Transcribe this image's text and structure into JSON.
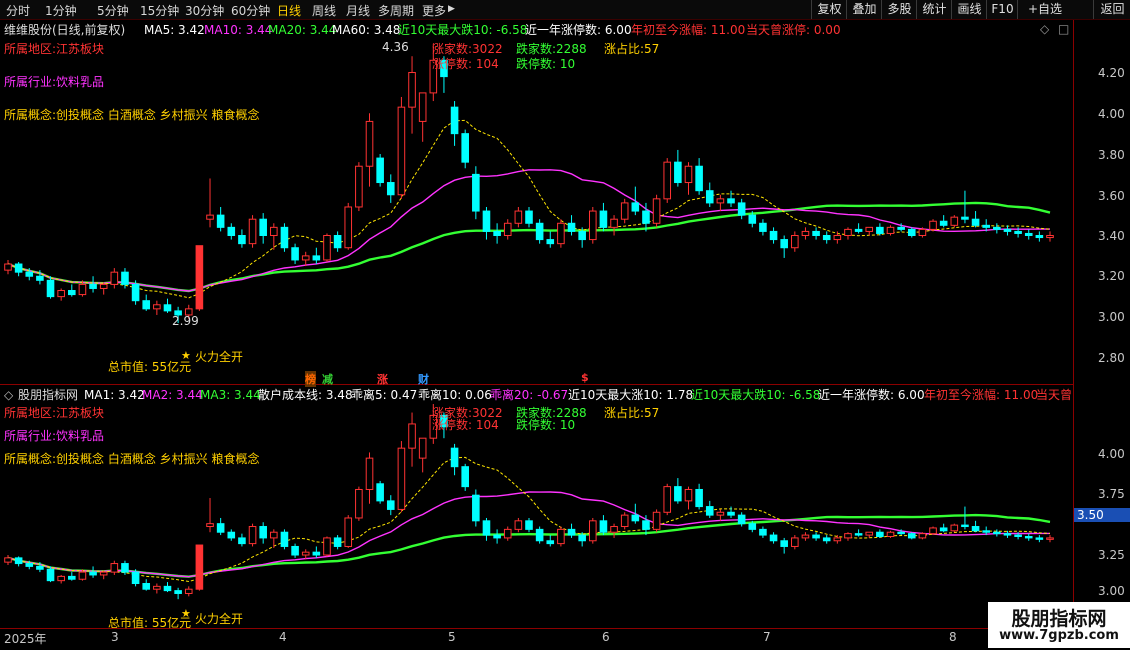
{
  "toolbar": {
    "periods": [
      "分时",
      "1分钟",
      "5分钟",
      "15分钟",
      "30分钟",
      "60分钟",
      "日线",
      "周线",
      "月线",
      "多周期",
      "更多"
    ],
    "active_period": "日线",
    "more_arrow": "▶",
    "buttons": [
      "复权",
      "叠加",
      "多股",
      "统计",
      "画线",
      "F10",
      "+自选",
      "返回"
    ]
  },
  "main_panel": {
    "title": "维维股份(日线,前复权)",
    "settings_icon": "◇",
    "close_icon": "□",
    "ma": [
      {
        "label": "MA5: 3.42",
        "color": "#ffffff"
      },
      {
        "label": "MA10: 3.44",
        "color": "#ff33ff"
      },
      {
        "label": "MA20: 3.44",
        "color": "#33ff33"
      },
      {
        "label": "MA60: 3.48",
        "color": "#ffffff"
      }
    ],
    "stats": [
      {
        "label": "近10天最大跌10: -6.58",
        "color": "#33ff33"
      },
      {
        "label": "近一年涨停数: 6.00",
        "color": "#ffffff"
      },
      {
        "label": "年初至今涨幅: 11.00",
        "color": "#ff3333"
      },
      {
        "label": "当天曾涨停: 0.00",
        "color": "#ff3333"
      }
    ],
    "region": "所属地区:江苏板块",
    "industry": "所属行业:饮料乳品",
    "concepts": "所属概念:创投概念 白酒概念 乡村振兴 粮食概念",
    "market_stats": {
      "up_count": "涨家数:3022",
      "down_count": "跌家数:2288",
      "up_ratio": "涨占比:57",
      "limit_up": "涨停数:   104",
      "limit_down": "跌停数:    10"
    },
    "high_label": "4.36",
    "low_label": "2.99",
    "market_cap": "总市值: 55亿元",
    "signal": "火力全开",
    "star": "★",
    "y_ticks": [
      "4.20",
      "4.00",
      "3.80",
      "3.60",
      "3.40",
      "3.20",
      "3.00",
      "2.80"
    ],
    "event_tags": [
      {
        "label": "榜",
        "color": "#ff6600"
      },
      {
        "label": "减",
        "color": "#33cc33"
      },
      {
        "label": "涨",
        "color": "#ff3333"
      },
      {
        "label": "财",
        "color": "#3399ff"
      },
      {
        "label": "$",
        "color": "#ff3333"
      }
    ]
  },
  "sub_panel": {
    "title": "股朋指标网",
    "lines": [
      {
        "label": "MA1: 3.42",
        "color": "#ffffff"
      },
      {
        "label": "MA2: 3.44",
        "color": "#ff33ff"
      },
      {
        "label": "MA3: 3.44",
        "color": "#33ff33"
      },
      {
        "label": "散户成本线: 3.48",
        "color": "#ffffff"
      },
      {
        "label": "乖离5: 0.47",
        "color": "#ffffff"
      },
      {
        "label": "乖离10: 0.06",
        "color": "#ffffff"
      },
      {
        "label": "乖离20: -0.67",
        "color": "#ff33ff"
      },
      {
        "label": "近10天最大涨10: 1.78",
        "color": "#ffffff"
      },
      {
        "label": "近10天最大跌10: -6.58",
        "color": "#33ff33"
      },
      {
        "label": "近一年涨停数: 6.00",
        "color": "#ffffff"
      },
      {
        "label": "年初至今涨幅: 11.00",
        "color": "#ff3333"
      },
      {
        "label": "当天曾",
        "color": "#ff3333"
      }
    ],
    "region": "所属地区:江苏板块",
    "industry": "所属行业:饮料乳品",
    "concepts": "所属概念:创投概念 白酒概念 乡村振兴 粮食概念",
    "market_stats": {
      "up_count": "涨家数:3022",
      "down_count": "跌家数:2288",
      "up_ratio": "涨占比:57",
      "limit_up": "涨停数:   104",
      "limit_down": "跌停数:    10"
    },
    "market_cap": "总市值: 55亿元",
    "signal": "火力全开",
    "star": "★",
    "y_ticks": [
      "4.00",
      "3.75",
      "3.25",
      "3.00"
    ],
    "current_price_tag": "3.50"
  },
  "x_axis": {
    "labels": [
      "2025年",
      "3",
      "4",
      "5",
      "6",
      "7",
      "8"
    ]
  },
  "watermark": {
    "title": "股朋指标网",
    "url": "www.7gpzb.com"
  },
  "colors": {
    "up": "#ff3333",
    "down": "#00ffff",
    "ma5": "#ffffff",
    "ma10": "#ff33ff",
    "ma20": "#33ff33",
    "border": "#8b0000"
  },
  "chart_data": {
    "type": "candlestick",
    "x_months": [
      "2025-02",
      "2025-03",
      "2025-04",
      "2025-05",
      "2025-06",
      "2025-07",
      "2025-08"
    ],
    "y_range_main": [
      2.75,
      4.36
    ],
    "y_range_sub": [
      2.9,
      4.36
    ],
    "candles": [
      [
        3.25,
        3.3,
        3.23,
        3.28
      ],
      [
        3.28,
        3.29,
        3.22,
        3.24
      ],
      [
        3.24,
        3.26,
        3.2,
        3.22
      ],
      [
        3.22,
        3.25,
        3.18,
        3.2
      ],
      [
        3.2,
        3.22,
        3.11,
        3.12
      ],
      [
        3.12,
        3.16,
        3.1,
        3.15
      ],
      [
        3.15,
        3.18,
        3.12,
        3.13
      ],
      [
        3.13,
        3.2,
        3.12,
        3.18
      ],
      [
        3.18,
        3.22,
        3.14,
        3.16
      ],
      [
        3.16,
        3.19,
        3.13,
        3.18
      ],
      [
        3.18,
        3.26,
        3.16,
        3.24
      ],
      [
        3.24,
        3.26,
        3.16,
        3.18
      ],
      [
        3.18,
        3.2,
        3.08,
        3.1
      ],
      [
        3.1,
        3.13,
        3.05,
        3.06
      ],
      [
        3.06,
        3.1,
        3.03,
        3.08
      ],
      [
        3.08,
        3.11,
        3.04,
        3.05
      ],
      [
        3.05,
        3.07,
        2.99,
        3.03
      ],
      [
        3.03,
        3.08,
        3.01,
        3.06
      ],
      [
        3.06,
        3.37,
        3.05,
        3.37
      ],
      [
        3.5,
        3.7,
        3.46,
        3.52
      ],
      [
        3.52,
        3.56,
        3.44,
        3.46
      ],
      [
        3.46,
        3.48,
        3.4,
        3.42
      ],
      [
        3.42,
        3.45,
        3.36,
        3.38
      ],
      [
        3.38,
        3.52,
        3.36,
        3.5
      ],
      [
        3.5,
        3.53,
        3.38,
        3.42
      ],
      [
        3.42,
        3.48,
        3.35,
        3.46
      ],
      [
        3.46,
        3.48,
        3.34,
        3.36
      ],
      [
        3.36,
        3.38,
        3.28,
        3.3
      ],
      [
        3.3,
        3.34,
        3.27,
        3.32
      ],
      [
        3.32,
        3.36,
        3.28,
        3.3
      ],
      [
        3.3,
        3.43,
        3.29,
        3.42
      ],
      [
        3.42,
        3.44,
        3.34,
        3.36
      ],
      [
        3.36,
        3.58,
        3.35,
        3.56
      ],
      [
        3.56,
        3.78,
        3.54,
        3.76
      ],
      [
        3.76,
        4.02,
        3.66,
        3.98
      ],
      [
        3.8,
        3.82,
        3.66,
        3.68
      ],
      [
        3.68,
        3.72,
        3.58,
        3.62
      ],
      [
        3.62,
        4.1,
        3.6,
        4.05
      ],
      [
        4.05,
        4.3,
        3.92,
        4.22
      ],
      [
        3.98,
        4.08,
        3.88,
        4.12
      ],
      [
        4.12,
        4.36,
        4.08,
        4.28
      ],
      [
        4.28,
        4.3,
        4.12,
        4.2
      ],
      [
        4.05,
        4.08,
        3.86,
        3.92
      ],
      [
        3.92,
        3.94,
        3.75,
        3.78
      ],
      [
        3.72,
        3.76,
        3.5,
        3.54
      ],
      [
        3.54,
        3.56,
        3.4,
        3.44
      ],
      [
        3.44,
        3.48,
        3.38,
        3.42
      ],
      [
        3.42,
        3.5,
        3.4,
        3.48
      ],
      [
        3.48,
        3.56,
        3.46,
        3.54
      ],
      [
        3.54,
        3.56,
        3.46,
        3.48
      ],
      [
        3.48,
        3.5,
        3.38,
        3.4
      ],
      [
        3.4,
        3.44,
        3.36,
        3.38
      ],
      [
        3.38,
        3.5,
        3.36,
        3.48
      ],
      [
        3.48,
        3.52,
        3.42,
        3.44
      ],
      [
        3.44,
        3.46,
        3.36,
        3.4
      ],
      [
        3.4,
        3.56,
        3.38,
        3.54
      ],
      [
        3.54,
        3.58,
        3.44,
        3.46
      ],
      [
        3.46,
        3.52,
        3.42,
        3.5
      ],
      [
        3.5,
        3.6,
        3.48,
        3.58
      ],
      [
        3.58,
        3.66,
        3.52,
        3.54
      ],
      [
        3.54,
        3.58,
        3.44,
        3.48
      ],
      [
        3.48,
        3.62,
        3.46,
        3.6
      ],
      [
        3.6,
        3.8,
        3.58,
        3.78
      ],
      [
        3.78,
        3.84,
        3.66,
        3.68
      ],
      [
        3.68,
        3.78,
        3.62,
        3.76
      ],
      [
        3.76,
        3.8,
        3.62,
        3.64
      ],
      [
        3.64,
        3.68,
        3.56,
        3.58
      ],
      [
        3.58,
        3.62,
        3.54,
        3.6
      ],
      [
        3.6,
        3.64,
        3.56,
        3.58
      ],
      [
        3.58,
        3.6,
        3.5,
        3.52
      ],
      [
        3.52,
        3.54,
        3.46,
        3.48
      ],
      [
        3.48,
        3.5,
        3.42,
        3.44
      ],
      [
        3.44,
        3.46,
        3.38,
        3.4
      ],
      [
        3.4,
        3.42,
        3.31,
        3.36
      ],
      [
        3.36,
        3.44,
        3.34,
        3.42
      ],
      [
        3.42,
        3.46,
        3.4,
        3.44
      ],
      [
        3.44,
        3.46,
        3.4,
        3.42
      ],
      [
        3.42,
        3.44,
        3.38,
        3.4
      ],
      [
        3.4,
        3.44,
        3.38,
        3.42
      ],
      [
        3.42,
        3.46,
        3.4,
        3.45
      ],
      [
        3.45,
        3.48,
        3.43,
        3.44
      ],
      [
        3.44,
        3.46,
        3.42,
        3.46
      ],
      [
        3.46,
        3.48,
        3.42,
        3.43
      ],
      [
        3.43,
        3.47,
        3.42,
        3.46
      ],
      [
        3.46,
        3.48,
        3.44,
        3.45
      ],
      [
        3.45,
        3.46,
        3.41,
        3.42
      ],
      [
        3.42,
        3.46,
        3.41,
        3.45
      ],
      [
        3.45,
        3.5,
        3.44,
        3.49
      ],
      [
        3.49,
        3.52,
        3.46,
        3.47
      ],
      [
        3.47,
        3.52,
        3.46,
        3.51
      ],
      [
        3.51,
        3.64,
        3.48,
        3.5
      ],
      [
        3.5,
        3.54,
        3.46,
        3.47
      ],
      [
        3.47,
        3.5,
        3.44,
        3.46
      ],
      [
        3.46,
        3.48,
        3.43,
        3.45
      ],
      [
        3.45,
        3.47,
        3.42,
        3.44
      ],
      [
        3.44,
        3.46,
        3.41,
        3.43
      ],
      [
        3.43,
        3.45,
        3.4,
        3.42
      ],
      [
        3.42,
        3.44,
        3.39,
        3.41
      ],
      [
        3.41,
        3.44,
        3.39,
        3.42
      ]
    ]
  }
}
